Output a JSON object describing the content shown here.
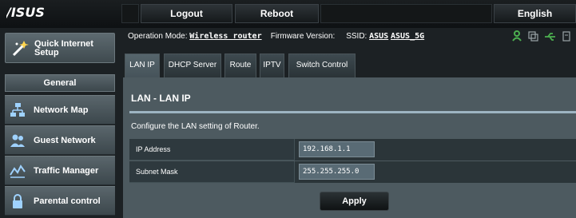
{
  "header": {
    "logo_text": "/ISUS",
    "logout_label": "Logout",
    "reboot_label": "Reboot",
    "language_label": "English"
  },
  "sidebar": {
    "quick_setup_label": "Quick Internet Setup",
    "section_title": "General",
    "items": [
      {
        "label": "Network Map",
        "icon": "network-map-icon"
      },
      {
        "label": "Guest Network",
        "icon": "guest-network-icon"
      },
      {
        "label": "Traffic Manager",
        "icon": "traffic-manager-icon"
      },
      {
        "label": "Parental control",
        "icon": "parental-control-icon"
      }
    ]
  },
  "status": {
    "operation_mode_label": "Operation Mode:",
    "operation_mode_value": "Wireless router",
    "firmware_label": "Firmware Version:",
    "ssid_label": "SSID:",
    "ssid_values": [
      "ASUS",
      "ASUS_5G"
    ],
    "icons": [
      "user-icon",
      "copy-icon",
      "usb-icon",
      "printer-icon"
    ]
  },
  "tabs": [
    {
      "label": "LAN IP",
      "active": true
    },
    {
      "label": "DHCP Server",
      "active": false
    },
    {
      "label": "Route",
      "active": false
    },
    {
      "label": "IPTV",
      "active": false
    },
    {
      "label": "Switch Control",
      "active": false
    }
  ],
  "panel": {
    "title": "LAN - LAN IP",
    "description": "Configure the LAN setting of Router.",
    "fields": [
      {
        "label": "IP Address",
        "value": "192.168.1.1"
      },
      {
        "label": "Subnet Mask",
        "value": "255.255.255.0"
      }
    ],
    "apply_label": "Apply"
  },
  "colors": {
    "accent_green": "#4caf50",
    "divider": "#9db4c2",
    "panel_bg": "#4d5a60"
  }
}
